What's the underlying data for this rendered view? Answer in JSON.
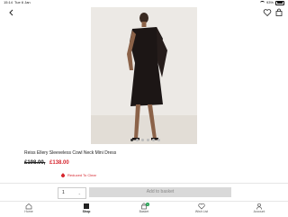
{
  "status_bar": {
    "time": "15:14",
    "date": "Tue 6 Jan",
    "battery": "93%"
  },
  "product": {
    "title": "Reiss Ellery Sleeveless Cowl Neck Mini Dress",
    "old_price": "£198.00,",
    "new_price": "£138.00",
    "reduced_label": "Reduced To Clear",
    "image_count": 6,
    "active_image": 1
  },
  "purchase": {
    "quantity": "1",
    "add_label": "Add to basket"
  },
  "tabs": [
    {
      "label": "Home"
    },
    {
      "label": "Shop"
    },
    {
      "label": "Basket",
      "badge": "1"
    },
    {
      "label": "Wish List"
    },
    {
      "label": "Account"
    }
  ],
  "colors": {
    "sale": "#d6272f",
    "badge": "#1a9e4b"
  }
}
